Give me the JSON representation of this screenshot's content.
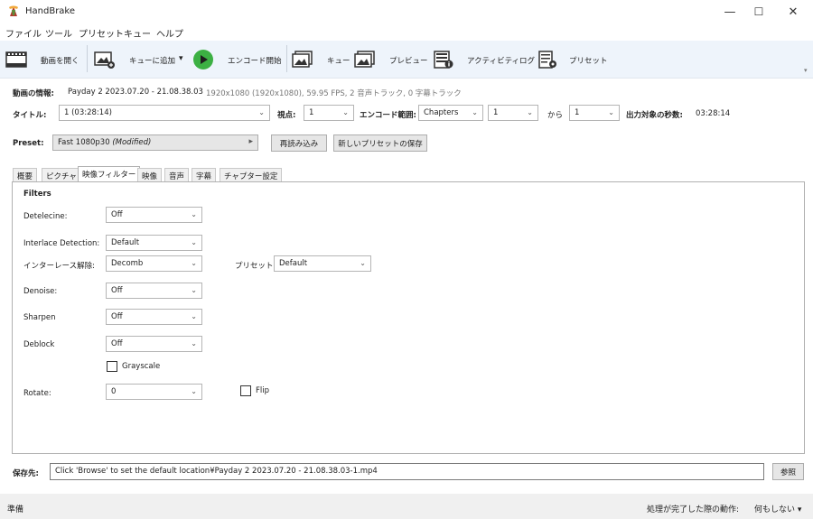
{
  "window": {
    "title": "HandBrake",
    "minimize": "—",
    "maximize": "☐",
    "close": "✕"
  },
  "menu": [
    "ファイル",
    "ツール",
    "プリセット",
    "キュー",
    "ヘルプ"
  ],
  "toolbar": {
    "open": "動画を開く",
    "add_queue": "キューに追加",
    "add_queue_arrow": "▾",
    "start": "エンコード開始",
    "queue": "キュー",
    "preview": "プレビュー",
    "activity": "アクティビティログ",
    "presets": "プリセット",
    "overflow": "▾"
  },
  "source": {
    "label": "動画の情報:",
    "name": "Payday 2 2023.07.20 - 21.08.38.03",
    "details": "1920x1080 (1920x1080), 59.95 FPS, 2 音声トラック, 0 字幕トラック"
  },
  "title_row": {
    "title_label": "タイトル:",
    "title_value": "1 (03:28:14)",
    "angle_label": "視点:",
    "angle_value": "1",
    "range_label": "エンコード範囲:",
    "range_type": "Chapters",
    "range_start": "1",
    "range_to": "から",
    "range_end": "1",
    "duration_label": "出力対象の秒数:",
    "duration_value": "03:28:14"
  },
  "preset_row": {
    "label": "Preset:",
    "name": "Fast 1080p30",
    "modified": "(Modified)",
    "arrow": "▸",
    "reload": "再読み込み",
    "save_new": "新しいプリセットの保存"
  },
  "tabs": [
    "概要",
    "ピクチャ",
    "映像フィルター",
    "映像",
    "音声",
    "字幕",
    "チャプター設定"
  ],
  "filters": {
    "heading": "Filters",
    "detelecine_label": "Detelecine:",
    "detelecine_value": "Off",
    "interlace_detection_label": "Interlace Detection:",
    "interlace_detection_value": "Default",
    "deinterlace_label": "インターレース解除:",
    "deinterlace_value": "Decomb",
    "deinterlace_preset_label": "プリセット:",
    "deinterlace_preset_value": "Default",
    "denoise_label": "Denoise:",
    "denoise_value": "Off",
    "sharpen_label": "Sharpen",
    "sharpen_value": "Off",
    "deblock_label": "Deblock",
    "deblock_value": "Off",
    "grayscale_label": "Grayscale",
    "rotate_label": "Rotate:",
    "rotate_value": "0",
    "flip_label": "Flip"
  },
  "destination": {
    "label": "保存先:",
    "value": "Click 'Browse' to set the default location¥Payday 2 2023.07.20 - 21.08.38.03-1.mp4",
    "browse": "参照"
  },
  "status": {
    "text": "準備",
    "when_done_label": "処理が完了した際の動作:",
    "when_done_value": "何もしない ▾"
  },
  "colors": {
    "toolbar_bg": "#eef4fb",
    "accent_green": "#3cb043",
    "status_bg": "#f0f0f0"
  }
}
